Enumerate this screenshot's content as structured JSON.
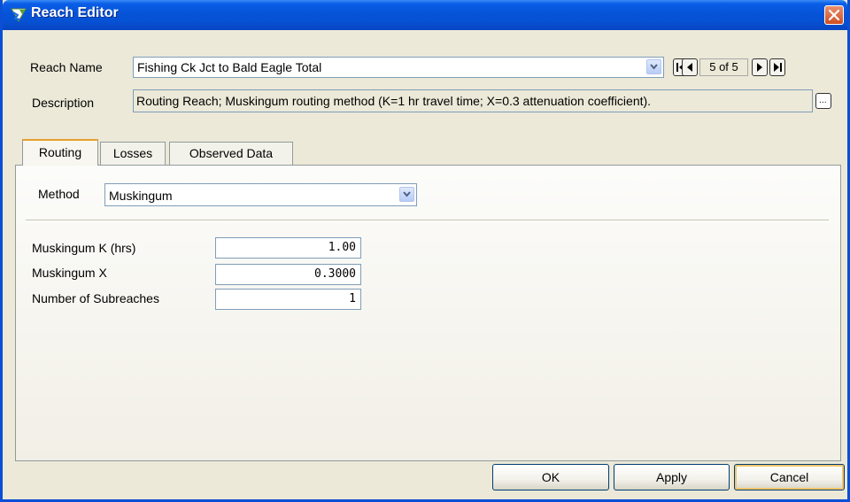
{
  "window": {
    "title": "Reach Editor"
  },
  "header": {
    "reach_name_label": "Reach Name",
    "reach_name_value": "Fishing Ck Jct to Bald Eagle Total",
    "record_counter": "5 of 5",
    "description_label": "Description",
    "description_value": "Routing Reach; Muskingum routing method (K=1 hr travel time; X=0.3 attenuation coefficient).",
    "description_button": "..."
  },
  "tabs": [
    {
      "label": "Routing",
      "active": true
    },
    {
      "label": "Losses",
      "active": false
    },
    {
      "label": "Observed Data",
      "active": false
    }
  ],
  "routing": {
    "method_label": "Method",
    "method_value": "Muskingum",
    "fields": [
      {
        "label": "Muskingum K (hrs)",
        "value": "1.00"
      },
      {
        "label": "Muskingum X",
        "value": "0.3000"
      },
      {
        "label": "Number of Subreaches",
        "value": "1"
      }
    ]
  },
  "buttons": {
    "ok": "OK",
    "apply": "Apply",
    "cancel": "Cancel"
  },
  "colors": {
    "titlebar": "#0653d8",
    "close": "#d14e21",
    "dialog_bg": "#ece9d8",
    "active_tab_accent": "#e7a02c"
  },
  "icons": [
    "reach-app-icon",
    "close-icon",
    "chevron-down-icon",
    "first-record-icon",
    "previous-record-icon",
    "next-record-icon",
    "last-record-icon"
  ]
}
